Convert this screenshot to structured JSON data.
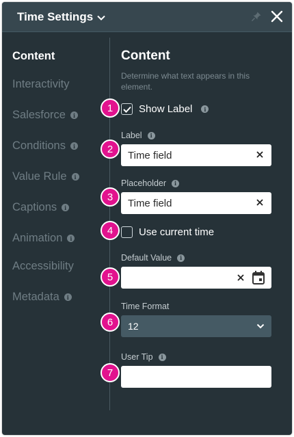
{
  "header": {
    "title": "Time Settings"
  },
  "sidebar": {
    "items": [
      {
        "label": "Content",
        "info": false
      },
      {
        "label": "Interactivity",
        "info": false
      },
      {
        "label": "Salesforce",
        "info": true
      },
      {
        "label": "Conditions",
        "info": true
      },
      {
        "label": "Value Rule",
        "info": true
      },
      {
        "label": "Captions",
        "info": true
      },
      {
        "label": "Animation",
        "info": true
      },
      {
        "label": "Accessibility",
        "info": false
      },
      {
        "label": "Metadata",
        "info": true
      }
    ],
    "active": "Content"
  },
  "content": {
    "title": "Content",
    "description": "Determine what text appears in this element.",
    "show_label": {
      "label": "Show Label",
      "checked": true
    },
    "label_field": {
      "label": "Label",
      "value": "Time field"
    },
    "placeholder_field": {
      "label": "Placeholder",
      "value": "Time field"
    },
    "use_current_time": {
      "label": "Use current time",
      "checked": false
    },
    "default_value": {
      "label": "Default Value",
      "value": ""
    },
    "time_format": {
      "label": "Time Format",
      "value": "12"
    },
    "user_tip": {
      "label": "User Tip",
      "value": ""
    }
  },
  "badges": [
    "1",
    "2",
    "3",
    "4",
    "5",
    "6",
    "7"
  ],
  "colors": {
    "panel_bg": "#263238",
    "header_bg": "#37474f",
    "badge": "#e2128e",
    "select_bg": "#455a64"
  }
}
